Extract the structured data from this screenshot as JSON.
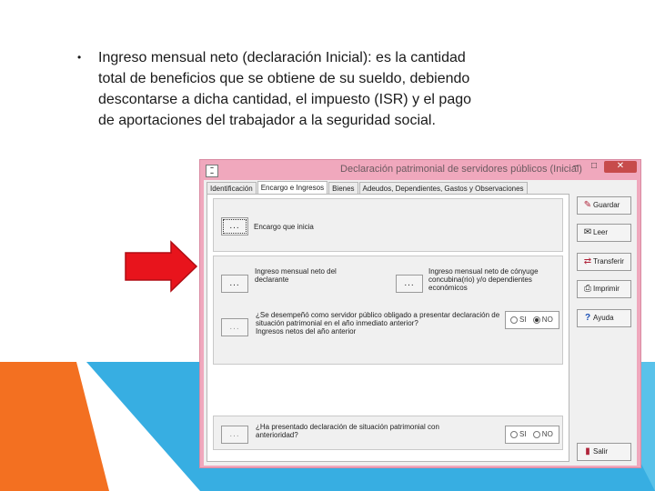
{
  "slide": {
    "bullet": "•",
    "lines": [
      "Ingreso mensual neto (declaración Inicial): es la cantidad",
      "total de beneficios que se obtiene de su sueldo, debiendo",
      "descontarse a dicha cantidad, el impuesto (ISR) y el pago",
      "de aportaciones del trabajador a la seguridad social."
    ]
  },
  "window": {
    "title": "Declaración patrimonial de servidores públicos (Inicial)",
    "min": "–",
    "max": "□",
    "close": "✕"
  },
  "tabs": [
    "Identificación",
    "Encargo e Ingresos",
    "Bienes",
    "Adeudos, Dependientes, Gastos y Observaciones"
  ],
  "form": {
    "dots": "...",
    "encargo_label": "Encargo que inicia",
    "ingreso_label": "Ingreso mensual neto del declarante",
    "conyuge_label": "Ingreso mensual neto de cónyuge concubina(rio) y/o dependientes económicos",
    "servidor_question": "¿Se desempeñó como servidor público obligado a presentar declaración de situación patrimonial en el año inmediato anterior?",
    "servidor_sub": "Ingresos netos del año anterior",
    "presentado_question": "¿Ha presentado declaración de situación patrimonial con anterioridad?",
    "si": "SI",
    "no": "NO"
  },
  "side_buttons": {
    "guardar": "Guardar",
    "leer": "Leer",
    "transferir": "Transferir",
    "imprimir": "Imprimir",
    "ayuda": "Ayuda",
    "salir": "Salir"
  },
  "colors": {
    "arrow": "#e8141c",
    "window_frame": "#f0a8bd",
    "accent_orange": "#f37021",
    "accent_blue": "#37aee2"
  }
}
